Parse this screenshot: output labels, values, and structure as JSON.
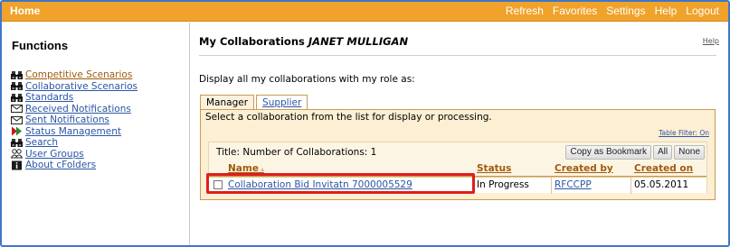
{
  "topbar": {
    "home": "Home",
    "menu": [
      "Refresh",
      "Favorites",
      "Settings",
      "Help",
      "Logout"
    ]
  },
  "sidebar": {
    "heading": "Functions",
    "items": [
      {
        "label": "Competitive Scenarios",
        "icon": "binoculars-icon",
        "active": true
      },
      {
        "label": "Collaborative Scenarios",
        "icon": "binoculars-icon",
        "active": false
      },
      {
        "label": "Standards",
        "icon": "binoculars-icon",
        "active": false
      },
      {
        "label": "Received Notifications",
        "icon": "envelope-icon",
        "active": false
      },
      {
        "label": "Sent Notifications",
        "icon": "envelope-icon",
        "active": false
      },
      {
        "label": "Status Management",
        "icon": "play-icon",
        "active": false
      },
      {
        "label": "Search",
        "icon": "binoculars-icon",
        "active": false
      },
      {
        "label": "User Groups",
        "icon": "users-icon",
        "active": false
      },
      {
        "label": "About cFolders",
        "icon": "info-icon",
        "active": false
      }
    ]
  },
  "main": {
    "title": "My Collaborations",
    "user": "JANET MULLIGAN",
    "help": "Help",
    "display_label": "Display all my collaborations with my role as:",
    "tabs": [
      "Manager",
      "Supplier"
    ],
    "select_message": "Select a collaboration from the list for display or processing.",
    "table_filter": "Table Filter: On",
    "count_label": "Title: Number of Collaborations: 1",
    "buttons": [
      "Copy as Bookmark",
      "All",
      "None"
    ],
    "columns": [
      "Name",
      "Status",
      "Created by",
      "Created on"
    ],
    "rows": [
      {
        "name": "Collaboration Bid Invitatn 7000005529",
        "status": "In Progress",
        "created_by": "RFCCPP",
        "created_on": "05.05.2011"
      }
    ]
  },
  "colors": {
    "topbar": "#f0a22a",
    "panel": "#fcefd3",
    "link": "#2a55a5",
    "header_link": "#a05b0d",
    "highlight": "#e01d1d"
  }
}
